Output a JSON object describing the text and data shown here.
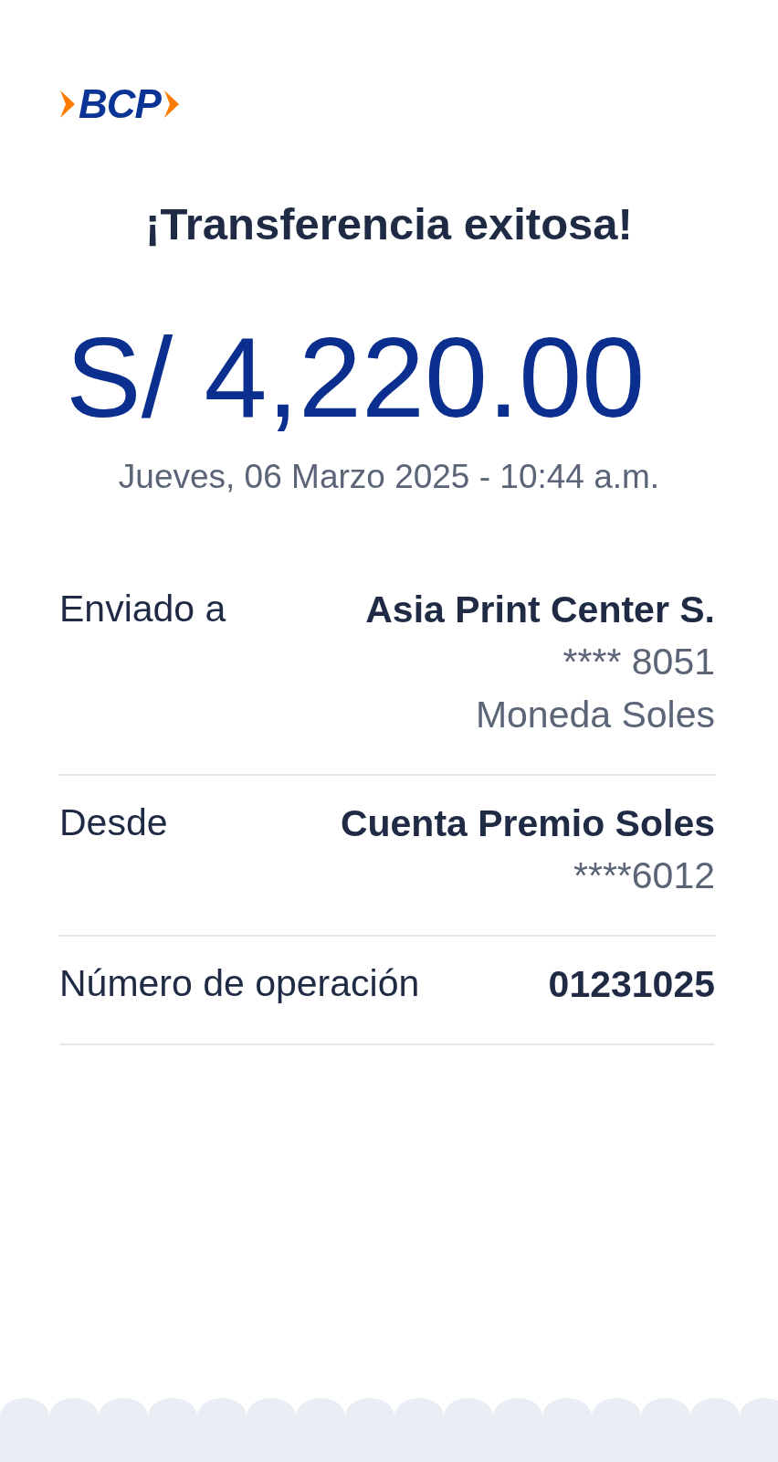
{
  "logo": {
    "text": "BCP"
  },
  "title": "¡Transferencia exitosa!",
  "amount": "S/ 4,220.00",
  "datetime": "Jueves, 06 Marzo 2025 - 10:44 a.m.",
  "details": [
    {
      "label": "Enviado a",
      "values": [
        "Asia Print Center S.",
        "**** 8051",
        "Moneda Soles"
      ]
    },
    {
      "label": "Desde",
      "values": [
        "Cuenta Premio Soles",
        "****6012"
      ]
    },
    {
      "label": "Número de operación",
      "values": [
        "01231025"
      ]
    }
  ]
}
